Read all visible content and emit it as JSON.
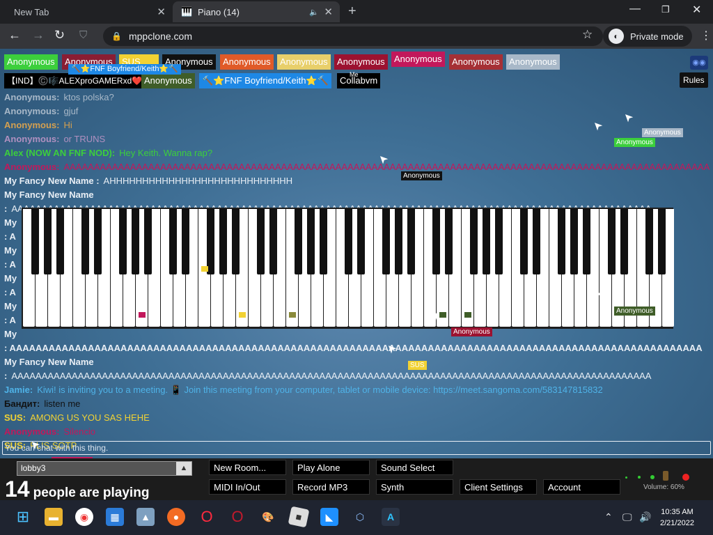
{
  "browser": {
    "tabs": [
      {
        "title": "New Tab",
        "active": false
      },
      {
        "title": "Piano (14)",
        "active": true
      }
    ],
    "url": "mppclone.com",
    "private_label": "Private mode"
  },
  "players": {
    "row1": [
      {
        "name": "Anonymous",
        "color": "#3ccf3c"
      },
      {
        "name": "Anonymous",
        "color": "#8a1d33"
      },
      {
        "name": "SUS",
        "color": "#f2d233"
      },
      {
        "name": "Anonymous",
        "color": "#111111"
      },
      {
        "name": "Anonymous",
        "color": "#e05a28"
      },
      {
        "name": "Anonymous",
        "color": "#e8cf6a"
      },
      {
        "name": "Anonymous",
        "color": "#9c1230"
      },
      {
        "name": "Anonymous",
        "color": "#c2185b"
      },
      {
        "name": "Anonymous",
        "color": "#a53035"
      },
      {
        "name": "Anonymous",
        "color": "#a8b8c8"
      }
    ],
    "row2": [
      {
        "name": "【IND】©️🎼ALEXproGAMERxd❤️⚔",
        "color": "#000000"
      },
      {
        "name": "Anonymous",
        "color": "#3f5d28"
      },
      {
        "name": "🔨⭐FNF Boyfriend/Keith⭐🔨",
        "color": "#1e88e5"
      },
      {
        "name": "Collabvm",
        "color": "#000000"
      }
    ],
    "floating_tag": "🔨⭐FNF Boyfriend/Keith⭐🔨",
    "me_label": "Me",
    "rules_label": "Rules"
  },
  "chat": [
    {
      "who": "Anonymous:",
      "text": "ktos polska?",
      "color": "#a8b8c8"
    },
    {
      "who": "Anonymous:",
      "text": "gjuf",
      "color": "#a8b8c8"
    },
    {
      "who": "Anonymous:",
      "text": "Hi",
      "color": "#d4a050"
    },
    {
      "who": "Anonymous:",
      "text": "or TRUNS",
      "color": "#b090c0"
    },
    {
      "who": "Alex (NOW AN FNF NOD):",
      "text": "Hey Keith. Wanna rap?",
      "color": "#3ccf3c"
    },
    {
      "who": "Anonymous:",
      "text": "AAAAAAAAAAAAAAAAAAAAAAAAAAAAAAAAAAAAAAAAAAAAAAAAAAAAAAAAAAAAAAAAAAAAAAAAAAAAAAAAAAAAAAAAAAAAAAAAAAAAAAAAAAA",
      "color": "#c2185b"
    },
    {
      "who": "My Fancy New Name :",
      "text": "AHHHHHHHHHHHHHHHHHHHHHHHHHHHH",
      "color": "#e8eef5"
    },
    {
      "who": "My Fancy New Name",
      "text": "",
      "color": "#e8eef5"
    },
    {
      "who": ":",
      "text": "AAAAAAAAAAAAAAAAAAAAAAAAAAAAAAAAAAAAAAAAAAAAAAAAAAAAAAAAAAAAAAAAAAAAAAAAAAAAAAAAAAAAAAAAAAAAAAAAAAAAAAAAAA",
      "color": "#e8eef5"
    },
    {
      "who": "My",
      "text": "",
      "color": "#e8eef5"
    },
    {
      "who": ": A",
      "text": "",
      "color": "#e8eef5"
    },
    {
      "who": "My",
      "text": "",
      "color": "#e8eef5"
    },
    {
      "who": ": A",
      "text": "",
      "color": "#e8eef5"
    },
    {
      "who": "My",
      "text": "",
      "color": "#e8eef5"
    },
    {
      "who": ": A",
      "text": "",
      "color": "#e8eef5"
    },
    {
      "who": "My",
      "text": "",
      "color": "#e8eef5"
    },
    {
      "who": ": A",
      "text": "",
      "color": "#e8eef5"
    },
    {
      "who": "My",
      "text": "",
      "color": "#e8eef5"
    },
    {
      "who": ": AAAAAAAAAAAAAAAAAAAAAAAAAAAAAAAAAAAAAAAAAAAAAAAAAAAAAAAAAAAAAAAAAAAAAAAAAAAAAAAAAAAAAAAAAAAAAAAAAAAAAAAAAA",
      "text": "",
      "color": "#e8eef5"
    },
    {
      "who": "My Fancy New Name",
      "text": "",
      "color": "#e8eef5"
    },
    {
      "who": ":",
      "text": "AAAAAAAAAAAAAAAAAAAAAAAAAAAAAAAAAAAAAAAAAAAAAAAAAAAAAAAAAAAAAAAAAAAAAAAAAAAAAAAAAAAAAAAAAAAAAAAAAAAAAAAAAA",
      "color": "#e8eef5"
    },
    {
      "who": "Jamie:",
      "text": "Kiwi! is inviting you to a meeting. 📱 Join this meeting from your computer, tablet or mobile device: https://meet.sangoma.com/583147815832",
      "color": "#4fb3e8"
    },
    {
      "who": "Бандит:",
      "text": "listen me",
      "color": "#111111"
    },
    {
      "who": "SUS:",
      "text": "AMONG US YOU SAS HEHE",
      "color": "#f2d233"
    },
    {
      "who": "Anonymous:",
      "text": "Silencio",
      "color": "#c2185b"
    },
    {
      "who": "SUS:",
      "text": "PLIS SOTP",
      "color": "#f2d233"
    }
  ],
  "cursors": [
    {
      "label": "Anonymous",
      "color": "#a8b8c8"
    },
    {
      "label": "Anonymous",
      "color": "#3ccf3c"
    },
    {
      "label": "Anonymous",
      "color": "#111111"
    },
    {
      "label": "Anonymous",
      "color": "#3f5d28"
    },
    {
      "label": "Anonymous",
      "color": "#9c1230"
    },
    {
      "label": "SUS",
      "color": "#f2d233"
    },
    {
      "label": "Anonymous",
      "color": "#c2185b"
    }
  ],
  "chat_input": {
    "placeholder": "You can chat with this thing."
  },
  "bottom": {
    "room": "lobby3",
    "player_count": "14",
    "players_label": "people are playing",
    "buttons_row1": [
      "New Room...",
      "Play Alone",
      "Sound Select"
    ],
    "buttons_row2": [
      "MIDI In/Out",
      "Record MP3",
      "Synth",
      "Client Settings",
      "Account"
    ],
    "volume": "Volume: 60%"
  },
  "taskbar": {
    "time": "10:35 AM",
    "date": "2/21/2022"
  },
  "piano_marks": [
    {
      "key": 9,
      "color": "#c2185b"
    },
    {
      "key": 14,
      "color": "#f2d233"
    },
    {
      "key": 17,
      "color": "#f2d233"
    },
    {
      "key": 21,
      "color": "#8a8a3a"
    },
    {
      "key": 33,
      "color": "#3f5d28"
    },
    {
      "key": 35,
      "color": "#3f5d28"
    }
  ]
}
